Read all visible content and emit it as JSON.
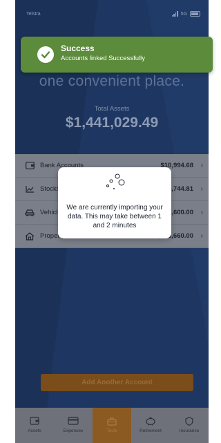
{
  "status_bar": {
    "carrier": "Telstra",
    "network": "5G"
  },
  "toast": {
    "title": "Success",
    "message": "Accounts linked Successfully",
    "color": "#5b8b3b"
  },
  "headline": "one convenient place.",
  "total": {
    "label": "Total Assets",
    "value": "$1,441,029.49"
  },
  "accounts": [
    {
      "icon": "wallet-icon",
      "label": "Bank Accounts",
      "amount": "$10,994.68"
    },
    {
      "icon": "chart-line-icon",
      "label": "Stocks & Crypto",
      "amount": "$114,744.81"
    },
    {
      "icon": "car-icon",
      "label": "Vehicles",
      "amount": "$86,600.00"
    },
    {
      "icon": "house-icon",
      "label": "Property",
      "amount": "$1,228,660.00"
    }
  ],
  "modal": {
    "message": "We are currently importing your data. This may take between 1 and 2 minutes"
  },
  "add_button": {
    "label": "Add Another Account",
    "color": "#f39c2b"
  },
  "tabs": [
    {
      "label": "Assets",
      "icon": "wallet-icon",
      "active": false
    },
    {
      "label": "Expenses",
      "icon": "card-icon",
      "active": false
    },
    {
      "label": "Tools",
      "icon": "toolbox-icon",
      "active": true
    },
    {
      "label": "Retirement",
      "icon": "piggy-bank-icon",
      "active": false
    },
    {
      "label": "Insurance",
      "icon": "shield-icon",
      "active": false
    }
  ],
  "colors": {
    "background": "#1d3561",
    "overlay": "rgba(0,0,0,0.55)",
    "accent": "#f39c2b"
  }
}
